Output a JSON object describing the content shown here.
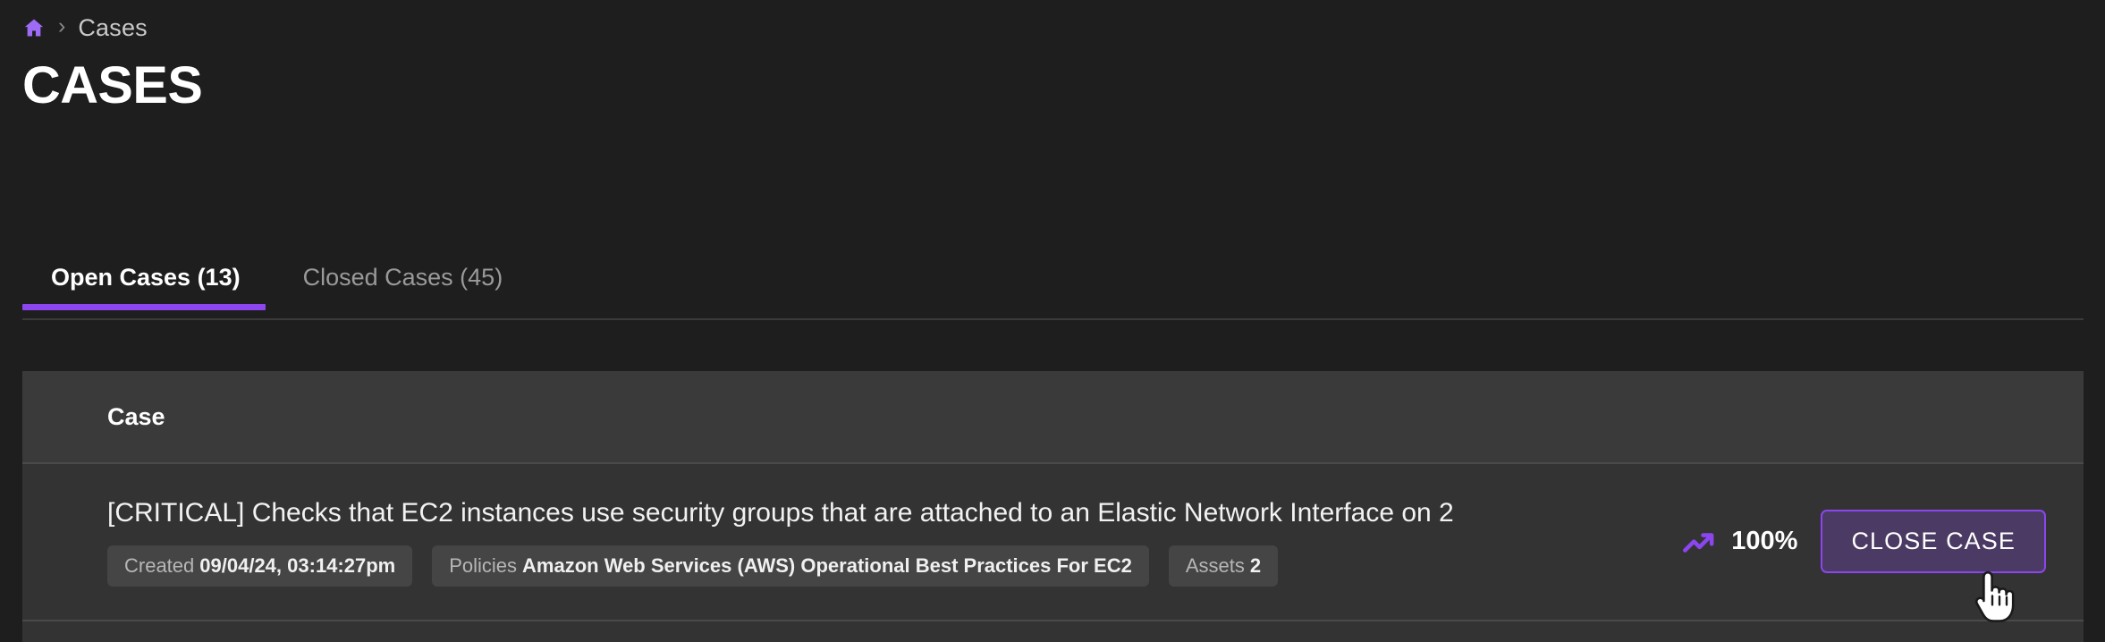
{
  "breadcrumb": {
    "home_icon": "home-icon",
    "separator": "›",
    "current": "Cases"
  },
  "page_title": "CASES",
  "tabs": [
    {
      "label": "Open Cases (13)",
      "active": true
    },
    {
      "label": "Closed Cases (45)",
      "active": false
    }
  ],
  "table": {
    "columns": [
      "Case"
    ],
    "rows": [
      {
        "title": "[CRITICAL] Checks that EC2 instances use security groups that are attached to an Elastic Network Interface on 2",
        "chips": [
          {
            "label": "Created",
            "value": "09/04/24, 03:14:27pm"
          },
          {
            "label": "Policies",
            "value": "Amazon Web Services (AWS) Operational Best Practices For EC2"
          },
          {
            "label": "Assets",
            "value": "2"
          }
        ],
        "trend_icon": "trending-up-icon",
        "score": "100%",
        "action_label": "CLOSE CASE"
      }
    ]
  },
  "colors": {
    "background": "#1e1e1e",
    "card": "#333333",
    "card_header": "#3a3a3a",
    "accent": "#8b46f0",
    "chip": "#454545",
    "button_fill": "#4b3a63",
    "text_primary": "#ffffff",
    "text_muted": "#9a9a9a"
  },
  "cursor": {
    "type": "pointing-hand"
  }
}
